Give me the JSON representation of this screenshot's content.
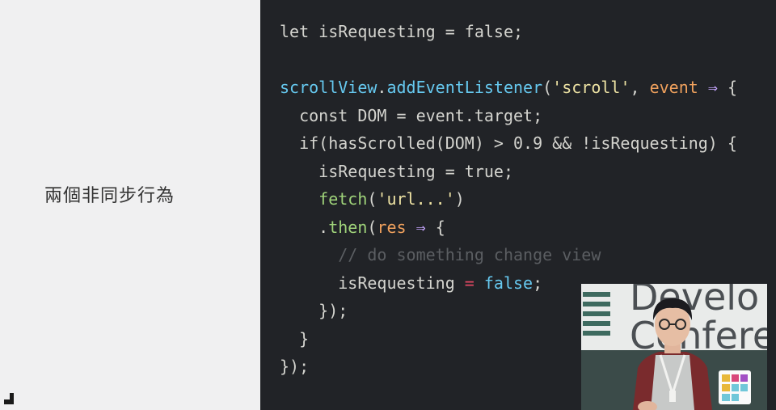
{
  "slide": {
    "heading": "兩個非同步行為"
  },
  "code": {
    "lines": [
      [
        {
          "t": "let isRequesting = false;",
          "c": ""
        }
      ],
      [
        {
          "t": "",
          "c": ""
        }
      ],
      [
        {
          "t": "scrollView",
          "c": "fn"
        },
        {
          "t": ".",
          "c": ""
        },
        {
          "t": "addEventListener",
          "c": "fn"
        },
        {
          "t": "(",
          "c": ""
        },
        {
          "t": "'scroll'",
          "c": "str"
        },
        {
          "t": ", ",
          "c": ""
        },
        {
          "t": "event",
          "c": "param"
        },
        {
          "t": " ⇒ ",
          "c": "arrow"
        },
        {
          "t": "{",
          "c": ""
        }
      ],
      [
        {
          "t": "  const DOM = event.target;",
          "c": ""
        }
      ],
      [
        {
          "t": "  if(hasScrolled(DOM) > 0.9 && !isRequesting) {",
          "c": ""
        }
      ],
      [
        {
          "t": "    isRequesting = true;",
          "c": ""
        }
      ],
      [
        {
          "t": "    ",
          "c": ""
        },
        {
          "t": "fetch",
          "c": "kw"
        },
        {
          "t": "(",
          "c": ""
        },
        {
          "t": "'url...'",
          "c": "str"
        },
        {
          "t": ")",
          "c": ""
        }
      ],
      [
        {
          "t": "    .",
          "c": ""
        },
        {
          "t": "then",
          "c": "kw"
        },
        {
          "t": "(",
          "c": ""
        },
        {
          "t": "res",
          "c": "param"
        },
        {
          "t": " ⇒ ",
          "c": "arrow"
        },
        {
          "t": "{",
          "c": ""
        }
      ],
      [
        {
          "t": "      // do something change view",
          "c": "comment"
        }
      ],
      [
        {
          "t": "      isRequesting ",
          "c": ""
        },
        {
          "t": "=",
          "c": "op"
        },
        {
          "t": " ",
          "c": ""
        },
        {
          "t": "false",
          "c": "fn"
        },
        {
          "t": ";",
          "c": ""
        }
      ],
      [
        {
          "t": "    });",
          "c": ""
        }
      ],
      [
        {
          "t": "  }",
          "c": ""
        }
      ],
      [
        {
          "t": "});",
          "c": ""
        }
      ]
    ]
  },
  "video": {
    "backdrop_text": "Develo\nConfere"
  }
}
